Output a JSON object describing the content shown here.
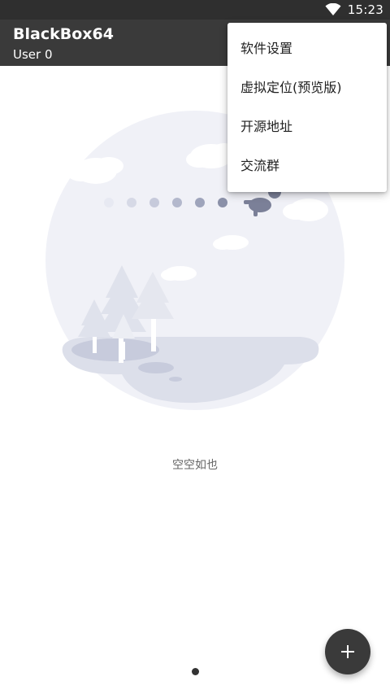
{
  "status_bar": {
    "time": "15:23",
    "wifi_icon": "wifi-icon"
  },
  "app_bar": {
    "title": "BlackBox64",
    "subtitle": "User 0"
  },
  "overflow_menu": {
    "items": [
      {
        "label": "软件设置"
      },
      {
        "label": "虚拟定位(预览版)"
      },
      {
        "label": "开源地址"
      },
      {
        "label": "交流群"
      }
    ]
  },
  "empty_state": {
    "text": "空空如也"
  },
  "fab": {
    "icon": "plus-icon"
  },
  "pager": {
    "current_page": 1,
    "total_pages": 1
  },
  "colors": {
    "status_bar": "#2f2f2f",
    "app_bar": "#3a3a3a",
    "fab": "#3a3a3a",
    "illustration_bg": "#f0f1f7",
    "illustration_accent": "#c8ccdc"
  }
}
